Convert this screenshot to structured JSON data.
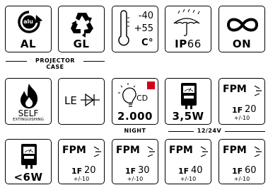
{
  "row1": {
    "recycle_al": {
      "logo": "alu",
      "label": "AL",
      "icon": "recycle-arrow-icon"
    },
    "recycle_gl": {
      "label": "GL",
      "icon": "recycle-triangle-icon"
    },
    "temperature": {
      "min": "-40",
      "max": "+55",
      "unit": "C°",
      "icon": "thermometer-icon"
    },
    "ip_rating": {
      "prefix": "IP",
      "value": "66",
      "icon": "umbrella-rain-icon"
    },
    "continuous": {
      "label": "ON",
      "icon": "infinity-icon"
    }
  },
  "projector_case_caption": {
    "line1": "PROJECTOR",
    "line2": "CASE"
  },
  "row2": {
    "self_extinguishing": {
      "line1": "SELF",
      "line2": "EXTINGUISHING",
      "icon": "flame-icon"
    },
    "led": {
      "text": "LE",
      "icon": "diode-icon"
    },
    "night": {
      "cd": "CD",
      "value": "2.000",
      "caption": "NIGHT",
      "icon": "bulb-icon",
      "accent": "#d0021b"
    },
    "power_3_5w": {
      "value": "3,5W",
      "icon": "wattmeter-icon"
    },
    "fpm_20_top": {
      "word": "FPM",
      "f": "1F",
      "value": "20",
      "tolerance": "+/-10",
      "icon": "flash-icon"
    }
  },
  "voltage_caption": "12/24V",
  "row3": {
    "power_lt_6w": {
      "value": "<6W",
      "icon": "wattmeter-icon"
    },
    "fpm_20": {
      "word": "FPM",
      "f": "1F",
      "value": "20",
      "tolerance": "+/-10"
    },
    "fpm_30": {
      "word": "FPM",
      "f": "1F",
      "value": "30",
      "tolerance": "+/-10"
    },
    "fpm_40": {
      "word": "FPM",
      "f": "1F",
      "value": "40",
      "tolerance": "+/-10"
    },
    "fpm_60": {
      "word": "FPM",
      "f": "1F",
      "value": "60",
      "tolerance": "+/-10"
    }
  }
}
